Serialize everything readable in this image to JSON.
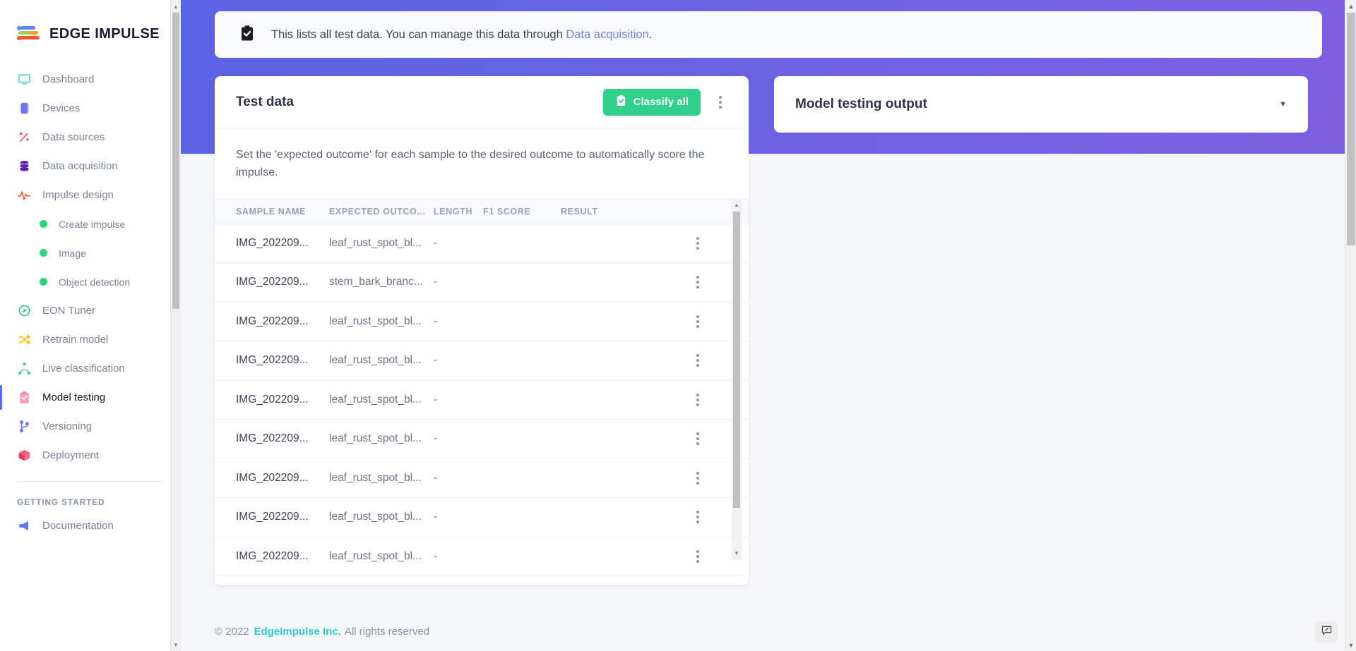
{
  "brand": {
    "name": "EDGE IMPULSE"
  },
  "colors": {
    "accent_purple": "#5c6bf2",
    "banner_gradient_start": "#5a63e0",
    "banner_gradient_end": "#7e5fe0",
    "green_button": "#2ed08a",
    "link_blue": "#6e87e8",
    "footer_brand": "#35c5d8",
    "sub_dot_green": "#2bd67b"
  },
  "sidebar": {
    "items": [
      {
        "label": "Dashboard",
        "icon": "monitor-icon",
        "active": false
      },
      {
        "label": "Devices",
        "icon": "chip-icon",
        "active": false
      },
      {
        "label": "Data sources",
        "icon": "wand-icon",
        "active": false
      },
      {
        "label": "Data acquisition",
        "icon": "database-icon",
        "active": false
      },
      {
        "label": "Impulse design",
        "icon": "pulse-icon",
        "active": false
      },
      {
        "label": "EON Tuner",
        "icon": "compass-icon",
        "active": false
      },
      {
        "label": "Retrain model",
        "icon": "shuffle-icon",
        "active": false
      },
      {
        "label": "Live classification",
        "icon": "graph-icon",
        "active": false
      },
      {
        "label": "Model testing",
        "icon": "clipboard-check-icon",
        "active": true
      },
      {
        "label": "Versioning",
        "icon": "branch-icon",
        "active": false
      },
      {
        "label": "Deployment",
        "icon": "box-icon",
        "active": false
      }
    ],
    "sub_items": [
      {
        "label": "Create impulse"
      },
      {
        "label": "Image"
      },
      {
        "label": "Object detection"
      }
    ],
    "section_heading": "GETTING STARTED",
    "documentation_label": "Documentation"
  },
  "alert": {
    "icon": "clipboard-check-icon",
    "text_before": "This lists all test data. You can manage this data through ",
    "link_text": "Data acquisition",
    "text_after": "."
  },
  "test_card": {
    "title": "Test data",
    "classify_button": "Classify all",
    "classify_icon": "clipboard-check-icon",
    "menu_icon": "kebab-menu-icon",
    "description": "Set the 'expected outcome' for each sample to the desired outcome to automatically score the impulse.",
    "columns": [
      "SAMPLE NAME",
      "EXPECTED OUTCO...",
      "LENGTH",
      "F1 SCORE",
      "RESULT"
    ],
    "rows": [
      {
        "sample_name": "IMG_202209...",
        "expected_outcome": "leaf_rust_spot_bl...",
        "length": "-",
        "f1_score": "",
        "result": ""
      },
      {
        "sample_name": "IMG_202209...",
        "expected_outcome": "stem_bark_branc...",
        "length": "-",
        "f1_score": "",
        "result": ""
      },
      {
        "sample_name": "IMG_202209...",
        "expected_outcome": "leaf_rust_spot_bl...",
        "length": "-",
        "f1_score": "",
        "result": ""
      },
      {
        "sample_name": "IMG_202209...",
        "expected_outcome": "leaf_rust_spot_bl...",
        "length": "-",
        "f1_score": "",
        "result": ""
      },
      {
        "sample_name": "IMG_202209...",
        "expected_outcome": "leaf_rust_spot_bl...",
        "length": "-",
        "f1_score": "",
        "result": ""
      },
      {
        "sample_name": "IMG_202209...",
        "expected_outcome": "leaf_rust_spot_bl...",
        "length": "-",
        "f1_score": "",
        "result": ""
      },
      {
        "sample_name": "IMG_202209...",
        "expected_outcome": "leaf_rust_spot_bl...",
        "length": "-",
        "f1_score": "",
        "result": ""
      },
      {
        "sample_name": "IMG_202209...",
        "expected_outcome": "leaf_rust_spot_bl...",
        "length": "-",
        "f1_score": "",
        "result": ""
      },
      {
        "sample_name": "IMG_202209...",
        "expected_outcome": "leaf_rust_spot_bl...",
        "length": "-",
        "f1_score": "",
        "result": ""
      }
    ]
  },
  "output_card": {
    "title": "Model testing output",
    "collapse_icon": "chevron-down-icon"
  },
  "footer": {
    "copyright": "© 2022",
    "company": "EdgeImpulse Inc.",
    "rights": "All rights reserved",
    "feedback_icon": "feedback-icon"
  }
}
